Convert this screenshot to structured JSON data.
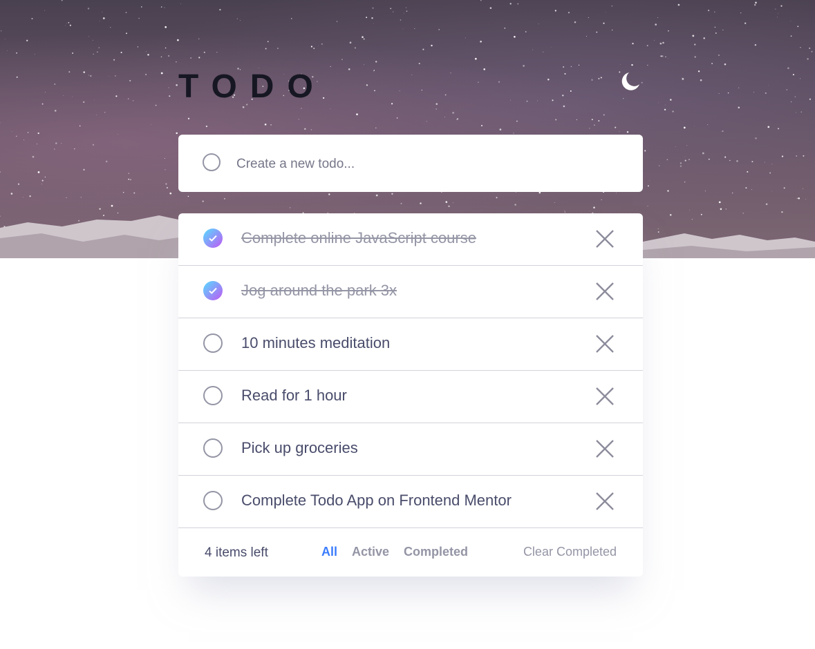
{
  "app": {
    "title": "TODO"
  },
  "theme": {
    "toggle_icon": "moon-icon",
    "accent_color": "#3a7cfd",
    "check_gradient": [
      "#55ddff",
      "#c058f3"
    ]
  },
  "new_todo": {
    "placeholder": "Create a new todo...",
    "value": ""
  },
  "todos": [
    {
      "text": "Complete online JavaScript course",
      "completed": true
    },
    {
      "text": "Jog around the park 3x",
      "completed": true
    },
    {
      "text": "10 minutes meditation",
      "completed": false
    },
    {
      "text": "Read for 1 hour",
      "completed": false
    },
    {
      "text": "Pick up groceries",
      "completed": false
    },
    {
      "text": "Complete Todo App on Frontend Mentor",
      "completed": false
    }
  ],
  "footer": {
    "items_left": "4 items left",
    "filters": [
      "All",
      "Active",
      "Completed"
    ],
    "active_filter": "All",
    "clear_label": "Clear Completed"
  }
}
